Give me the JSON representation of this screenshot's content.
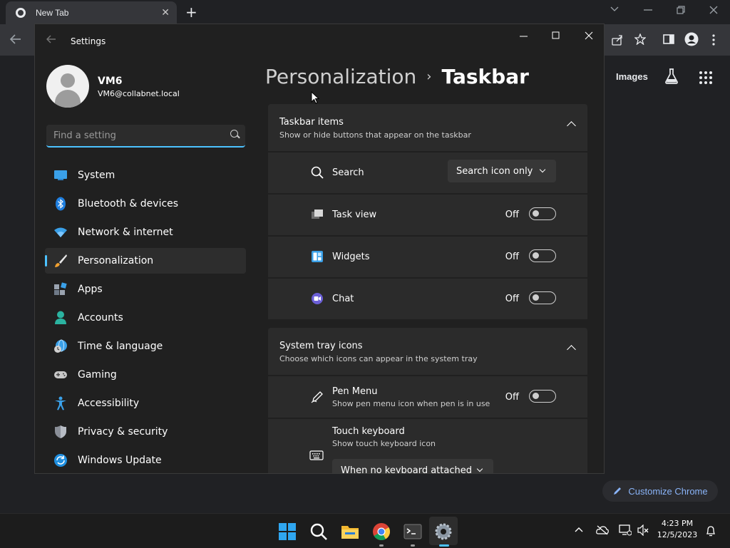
{
  "chrome": {
    "tab_title": "New Tab",
    "tab_close": "✕",
    "new_tab": "+",
    "images_link": "Images",
    "customize_label": "Customize Chrome"
  },
  "settings": {
    "window_title": "Settings",
    "profile": {
      "name": "VM6",
      "email": "VM6@collabnet.local"
    },
    "search": {
      "placeholder": "Find a setting"
    },
    "nav": [
      {
        "label": "System",
        "icon": "monitor-icon"
      },
      {
        "label": "Bluetooth & devices",
        "icon": "bluetooth-icon"
      },
      {
        "label": "Network & internet",
        "icon": "wifi-icon"
      },
      {
        "label": "Personalization",
        "icon": "brush-icon",
        "active": true
      },
      {
        "label": "Apps",
        "icon": "apps-icon"
      },
      {
        "label": "Accounts",
        "icon": "person-icon"
      },
      {
        "label": "Time & language",
        "icon": "globe-clock-icon"
      },
      {
        "label": "Gaming",
        "icon": "gamepad-icon"
      },
      {
        "label": "Accessibility",
        "icon": "accessibility-icon"
      },
      {
        "label": "Privacy & security",
        "icon": "shield-icon"
      },
      {
        "label": "Windows Update",
        "icon": "update-icon"
      }
    ],
    "breadcrumb": {
      "parent": "Personalization",
      "separator": "›",
      "current": "Taskbar"
    },
    "taskbar_items": {
      "title": "Taskbar items",
      "subtitle": "Show or hide buttons that appear on the taskbar",
      "search": {
        "label": "Search",
        "value": "Search icon only"
      },
      "task_view": {
        "label": "Task view",
        "state": "Off"
      },
      "widgets": {
        "label": "Widgets",
        "state": "Off"
      },
      "chat": {
        "label": "Chat",
        "state": "Off"
      }
    },
    "system_tray": {
      "title": "System tray icons",
      "subtitle": "Choose which icons can appear in the system tray",
      "pen_menu": {
        "label": "Pen Menu",
        "sub": "Show pen menu icon when pen is in use",
        "state": "Off"
      },
      "touch_keyboard": {
        "label": "Touch keyboard",
        "sub": "Show touch keyboard icon",
        "value": "When no keyboard attached"
      }
    }
  },
  "taskbar": {
    "time": "4:23 PM",
    "date": "12/5/2023"
  }
}
